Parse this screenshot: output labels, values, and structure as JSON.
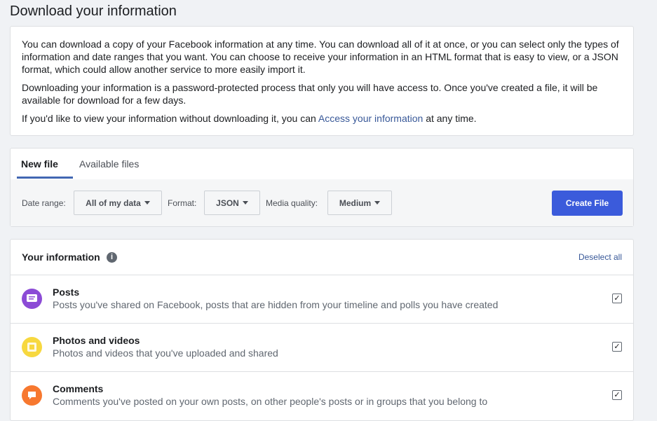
{
  "page": {
    "title": "Download your information"
  },
  "intro": {
    "p1": "You can download a copy of your Facebook information at any time. You can download all of it at once, or you can select only the types of information and date ranges that you want. You can choose to receive your information in an HTML format that is easy to view, or a JSON format, which could allow another service to more easily import it.",
    "p2": "Downloading your information is a password-protected process that only you will have access to. Once you've created a file, it will be available for download for a few days.",
    "p3_before": "If you'd like to view your information without downloading it, you can ",
    "p3_link": "Access your information",
    "p3_after": " at any time."
  },
  "tabs": [
    {
      "label": "New file",
      "active": true
    },
    {
      "label": "Available files",
      "active": false
    }
  ],
  "controls": {
    "date_range_label": "Date range:",
    "date_range_value": "All of my data",
    "format_label": "Format:",
    "format_value": "JSON",
    "media_quality_label": "Media quality:",
    "media_quality_value": "Medium",
    "create_button": "Create File"
  },
  "info": {
    "title": "Your information",
    "info_icon": "i",
    "deselect_all": "Deselect all",
    "items": [
      {
        "title": "Posts",
        "desc": "Posts you've shared on Facebook, posts that are hidden from your timeline and polls you have created",
        "icon": "posts-icon",
        "color": "#8c4bd6",
        "checked": true
      },
      {
        "title": "Photos and videos",
        "desc": "Photos and videos that you've uploaded and shared",
        "icon": "photos-icon",
        "color": "#f7d83f",
        "checked": true
      },
      {
        "title": "Comments",
        "desc": "Comments you've posted on your own posts, on other people's posts or in groups that you belong to",
        "icon": "comments-icon",
        "color": "#f7782f",
        "checked": true
      }
    ],
    "check_glyph": "✓"
  },
  "colors": {
    "accent": "#4267b2",
    "button": "#3b5bdb",
    "link": "#385898"
  }
}
